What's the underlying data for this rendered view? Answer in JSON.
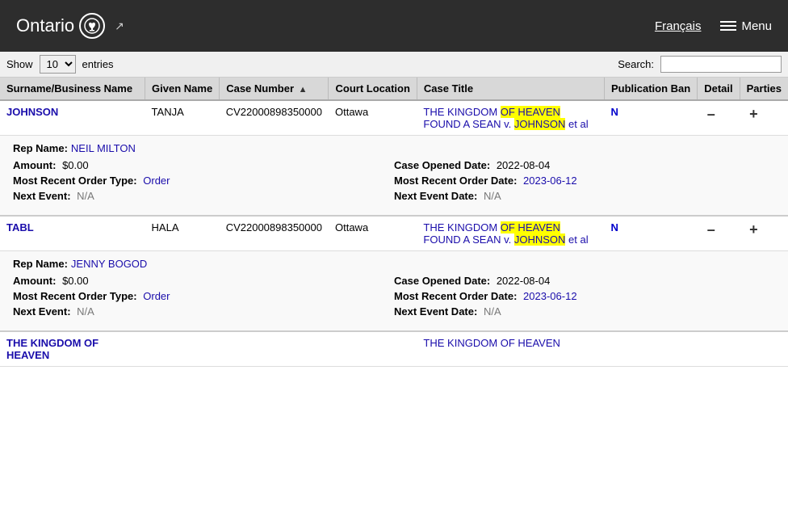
{
  "header": {
    "ontario_text": "Ontario",
    "ontario_icon": "⊕",
    "external_link": "↗",
    "francais_label": "Français",
    "menu_label": "Menu"
  },
  "controls": {
    "show_label": "Show",
    "show_value": "10",
    "entries_label": "entries",
    "search_label": "Search:",
    "search_placeholder": ""
  },
  "table": {
    "columns": [
      {
        "id": "surname",
        "label": "Surname/Business Name",
        "sortable": false
      },
      {
        "id": "given",
        "label": "Given Name",
        "sortable": false
      },
      {
        "id": "case_number",
        "label": "Case Number",
        "sortable": true,
        "sort_dir": "asc"
      },
      {
        "id": "court_location",
        "label": "Court Location",
        "sortable": false
      },
      {
        "id": "case_title",
        "label": "Case Title",
        "sortable": false
      },
      {
        "id": "publication_ban",
        "label": "Publication Ban",
        "sortable": false
      },
      {
        "id": "detail",
        "label": "Detail",
        "sortable": false
      },
      {
        "id": "parties",
        "label": "Parties",
        "sortable": false
      }
    ],
    "rows": [
      {
        "id": "row1",
        "surname": "JOHNSON",
        "given_name": "TANJA",
        "case_number": "CV22000898350000",
        "court_location": "Ottawa",
        "case_title_parts": [
          {
            "text": "THE KINGDOM ",
            "highlight": false
          },
          {
            "text": "OF HEAVEN",
            "highlight": true
          },
          {
            "text": " FOUND A SEAN v. ",
            "highlight": false
          },
          {
            "text": "JOHNSON",
            "highlight": true
          },
          {
            "text": " et al",
            "highlight": false
          }
        ],
        "case_title_full": "THE KINGDOM OF HEAVEN FOUND A SEAN v. JOHNSON et al",
        "publication_ban": "N",
        "detail_action": "–",
        "parties_action": "+",
        "detail": {
          "rep_name": "NEIL MILTON",
          "amount_label": "Amount:",
          "amount_value": "$0.00",
          "case_opened_label": "Case Opened Date:",
          "case_opened_value": "2022-08-04",
          "order_type_label": "Most Recent Order Type:",
          "order_type_value": "Order",
          "order_date_label": "Most Recent Order Date:",
          "order_date_value": "2023-06-12",
          "next_event_label": "Next Event:",
          "next_event_value": "N/A",
          "next_event_date_label": "Next Event Date:",
          "next_event_date_value": "N/A"
        }
      },
      {
        "id": "row2",
        "surname": "TABL",
        "given_name": "HALA",
        "case_number": "CV22000898350000",
        "court_location": "Ottawa",
        "case_title_parts": [
          {
            "text": "THE KINGDOM ",
            "highlight": false
          },
          {
            "text": "OF HEAVEN",
            "highlight": true
          },
          {
            "text": " FOUND A SEAN v. ",
            "highlight": false
          },
          {
            "text": "JOHNSON",
            "highlight": true
          },
          {
            "text": " et al",
            "highlight": false
          }
        ],
        "case_title_full": "THE KINGDOM OF HEAVEN FOUND A SEAN v. JOHNSON et al",
        "publication_ban": "N",
        "detail_action": "–",
        "parties_action": "+",
        "detail": {
          "rep_name": "JENNY BOGOD",
          "amount_label": "Amount:",
          "amount_value": "$0.00",
          "case_opened_label": "Case Opened Date:",
          "case_opened_value": "2022-08-04",
          "order_type_label": "Most Recent Order Type:",
          "order_type_value": "Order",
          "order_date_label": "Most Recent Order Date:",
          "order_date_value": "2023-06-12",
          "next_event_label": "Next Event:",
          "next_event_value": "N/A",
          "next_event_date_label": "Next Event Date:",
          "next_event_date_value": "N/A"
        }
      },
      {
        "id": "row3",
        "surname": "THE KINGDOM OF HEAVEN",
        "given_name": "",
        "case_number": "",
        "court_location": "",
        "case_title_full": "THE KINGDOM OF HEAVEN",
        "publication_ban": "",
        "detail_action": "",
        "parties_action": "",
        "partial": true
      }
    ]
  }
}
